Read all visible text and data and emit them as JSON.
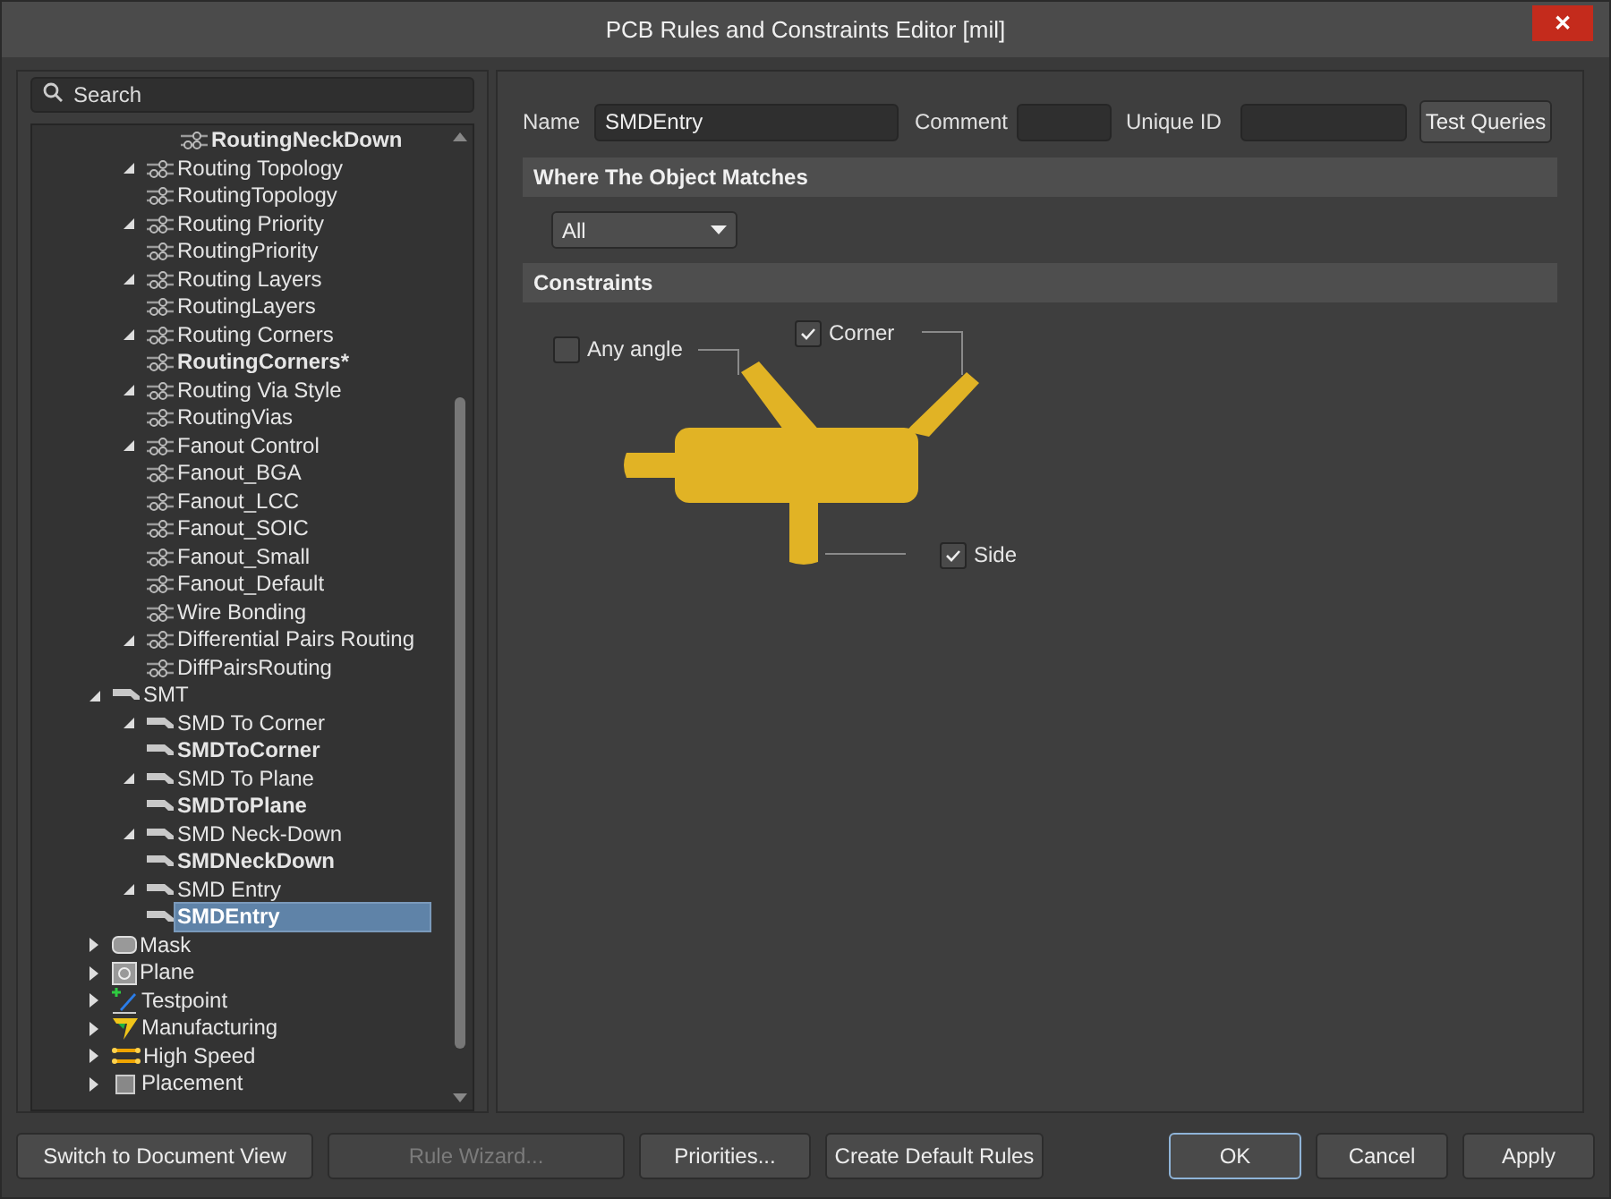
{
  "window": {
    "title": "PCB Rules and Constraints Editor [mil]",
    "close_label": "✕"
  },
  "search": {
    "placeholder": "Search"
  },
  "tree": {
    "continued_rules": [
      {
        "label": "RoutingNeckDown",
        "kind": "routing",
        "bold": true,
        "selected": false
      }
    ],
    "routing_branch": [
      {
        "label": "Routing Topology",
        "kind": "routing",
        "expanded": true,
        "children": [
          {
            "label": "RoutingTopology",
            "kind": "routing",
            "bold": false,
            "selected": false
          }
        ]
      },
      {
        "label": "Routing Priority",
        "kind": "routing",
        "expanded": true,
        "children": [
          {
            "label": "RoutingPriority",
            "kind": "routing",
            "bold": false,
            "selected": false
          }
        ]
      },
      {
        "label": "Routing Layers",
        "kind": "routing",
        "expanded": true,
        "children": [
          {
            "label": "RoutingLayers",
            "kind": "routing",
            "bold": false,
            "selected": false
          }
        ]
      },
      {
        "label": "Routing Corners",
        "kind": "routing",
        "expanded": true,
        "children": [
          {
            "label": "RoutingCorners*",
            "kind": "routing",
            "bold": true,
            "selected": false
          }
        ]
      },
      {
        "label": "Routing Via Style",
        "kind": "routing",
        "expanded": true,
        "children": [
          {
            "label": "RoutingVias",
            "kind": "routing",
            "bold": false,
            "selected": false
          }
        ]
      },
      {
        "label": "Fanout Control",
        "kind": "routing",
        "expanded": true,
        "children": [
          {
            "label": "Fanout_BGA",
            "kind": "routing",
            "bold": false,
            "selected": false
          },
          {
            "label": "Fanout_LCC",
            "kind": "routing",
            "bold": false,
            "selected": false
          },
          {
            "label": "Fanout_SOIC",
            "kind": "routing",
            "bold": false,
            "selected": false
          },
          {
            "label": "Fanout_Small",
            "kind": "routing",
            "bold": false,
            "selected": false
          },
          {
            "label": "Fanout_Default",
            "kind": "routing",
            "bold": false,
            "selected": false
          }
        ]
      },
      {
        "label": "Wire Bonding",
        "kind": "routing"
      },
      {
        "label": "Differential Pairs Routing",
        "kind": "routing",
        "expanded": true,
        "children": [
          {
            "label": "DiffPairsRouting",
            "kind": "routing",
            "bold": false,
            "selected": false
          }
        ]
      }
    ],
    "categories": [
      {
        "label": "SMT",
        "kind": "smt",
        "expanded": true,
        "children": [
          {
            "label": "SMD To Corner",
            "kind": "smt",
            "expanded": true,
            "children": [
              {
                "label": "SMDToCorner",
                "kind": "smt",
                "bold": true,
                "selected": false
              }
            ]
          },
          {
            "label": "SMD To Plane",
            "kind": "smt",
            "expanded": true,
            "children": [
              {
                "label": "SMDToPlane",
                "kind": "smt",
                "bold": true,
                "selected": false
              }
            ]
          },
          {
            "label": "SMD Neck-Down",
            "kind": "smt",
            "expanded": true,
            "children": [
              {
                "label": "SMDNeckDown",
                "kind": "smt",
                "bold": true,
                "selected": false
              }
            ]
          },
          {
            "label": "SMD Entry",
            "kind": "smt",
            "expanded": true,
            "children": [
              {
                "label": "SMDEntry",
                "kind": "smt",
                "bold": true,
                "selected": true
              }
            ]
          }
        ]
      },
      {
        "label": "Mask",
        "kind": "mask",
        "expanded": false
      },
      {
        "label": "Plane",
        "kind": "plane",
        "expanded": false
      },
      {
        "label": "Testpoint",
        "kind": "testpoint",
        "expanded": false
      },
      {
        "label": "Manufacturing",
        "kind": "manufacturing",
        "expanded": false
      },
      {
        "label": "High Speed",
        "kind": "highspeed",
        "expanded": false
      },
      {
        "label": "Placement",
        "kind": "placement",
        "expanded": false
      }
    ]
  },
  "rule": {
    "name_label": "Name",
    "name": "SMDEntry",
    "comment_label": "Comment",
    "unique_id_label": "Unique ID",
    "test_button": "Test Queries",
    "where_heading": "Where The Object Matches",
    "scope": "All",
    "constraints_heading": "Constraints",
    "options": [
      {
        "label": "Any angle",
        "checked": false
      },
      {
        "label": "Corner",
        "checked": true
      },
      {
        "label": "Side",
        "checked": true
      }
    ]
  },
  "footer": {
    "left_buttons": [
      {
        "label": "Switch to Document View",
        "disabled": false
      },
      {
        "label": "Rule Wizard...",
        "disabled": true
      },
      {
        "label": "Priorities...",
        "disabled": false
      },
      {
        "label": "Create Default Rules",
        "disabled": false
      }
    ],
    "right_buttons": [
      {
        "label": "OK",
        "default": true
      },
      {
        "label": "Cancel",
        "default": false
      },
      {
        "label": "Apply",
        "default": false
      }
    ]
  }
}
